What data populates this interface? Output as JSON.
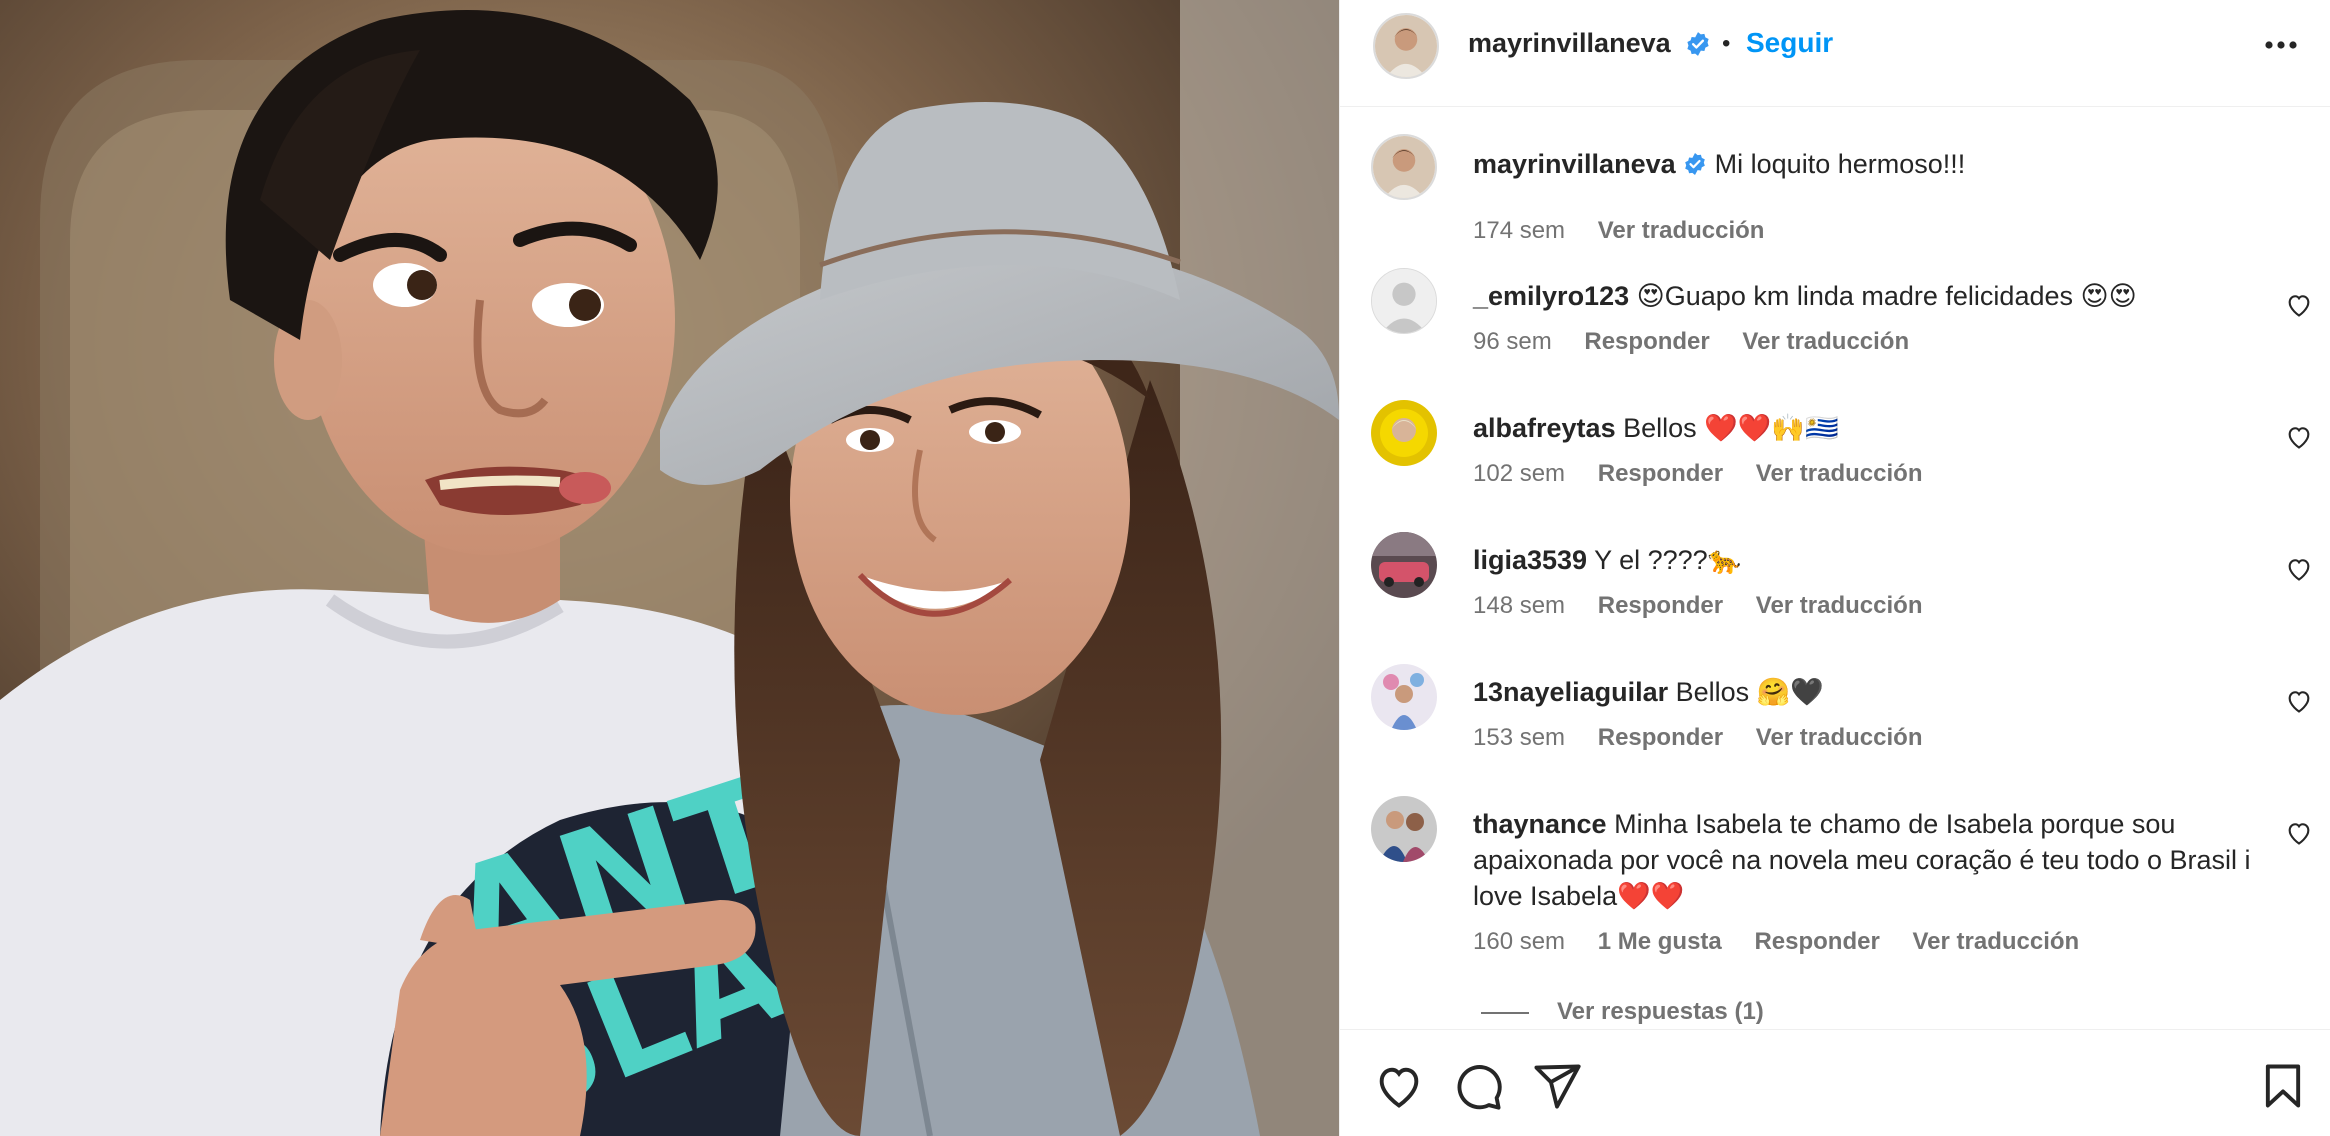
{
  "post": {
    "author": "mayrinvillaneva",
    "follow_label": "Seguir",
    "separator": "•",
    "more_icon": "more-horizontal-icon",
    "verified_icon": "verified-badge-icon",
    "verified_color": "#3897f0",
    "accent": "#0095f6"
  },
  "caption": {
    "user": "mayrinvillaneva",
    "text": "Mi loquito hermoso!!!",
    "time": "174 sem",
    "translate": "Ver traducción"
  },
  "comments": [
    {
      "user": "_emilyro123",
      "text": "😍Guapo km linda madre felicidades 😍😍",
      "time": "96 sem",
      "reply": "Responder",
      "translate": "Ver traducción"
    },
    {
      "user": "albafreytas",
      "text": "Bellos ❤️❤️🙌🇺🇾",
      "time": "102 sem",
      "reply": "Responder",
      "translate": "Ver traducción"
    },
    {
      "user": "ligia3539",
      "text": "Y el ????🐆",
      "time": "148 sem",
      "reply": "Responder",
      "translate": "Ver traducción"
    },
    {
      "user": "13nayeliaguilar",
      "text": "Bellos 🤗🖤",
      "time": "153 sem",
      "reply": "Responder",
      "translate": "Ver traducción"
    },
    {
      "user": "thaynance",
      "text": "Minha Isabela te chamo de Isabela porque sou apaixonada por você na novela meu coração é teu todo o Brasil i love Isabela❤️❤️",
      "time": "160 sem",
      "likes": "1 Me gusta",
      "reply": "Responder",
      "translate": "Ver traducción",
      "view_replies": "Ver respuestas (1)"
    }
  ],
  "icons": {
    "like": "heart-icon",
    "comment": "comment-icon",
    "share": "send-icon",
    "save": "bookmark-icon"
  }
}
